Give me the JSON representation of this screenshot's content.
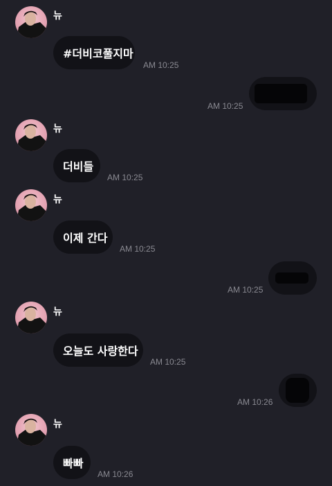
{
  "messages": [
    {
      "sender": "뉴",
      "text": "#더비코풀지마",
      "time": "AM 10:25"
    },
    {
      "time": "AM 10:25"
    },
    {
      "sender": "뉴",
      "text": "더비들",
      "time": "AM 10:25"
    },
    {
      "sender": "뉴",
      "text": "이제 간다",
      "time": "AM 10:25"
    },
    {
      "time": "AM 10:25"
    },
    {
      "sender": "뉴",
      "text": "오늘도 사랑한다",
      "time": "AM 10:25"
    },
    {
      "time": "AM 10:26"
    },
    {
      "sender": "뉴",
      "text": "빠빠",
      "time": "AM 10:26"
    }
  ],
  "colors": {
    "background": "#202028",
    "bubble": "#121217",
    "timestamp": "#8a8a92",
    "avatar_bg": "#e7a9b8"
  }
}
